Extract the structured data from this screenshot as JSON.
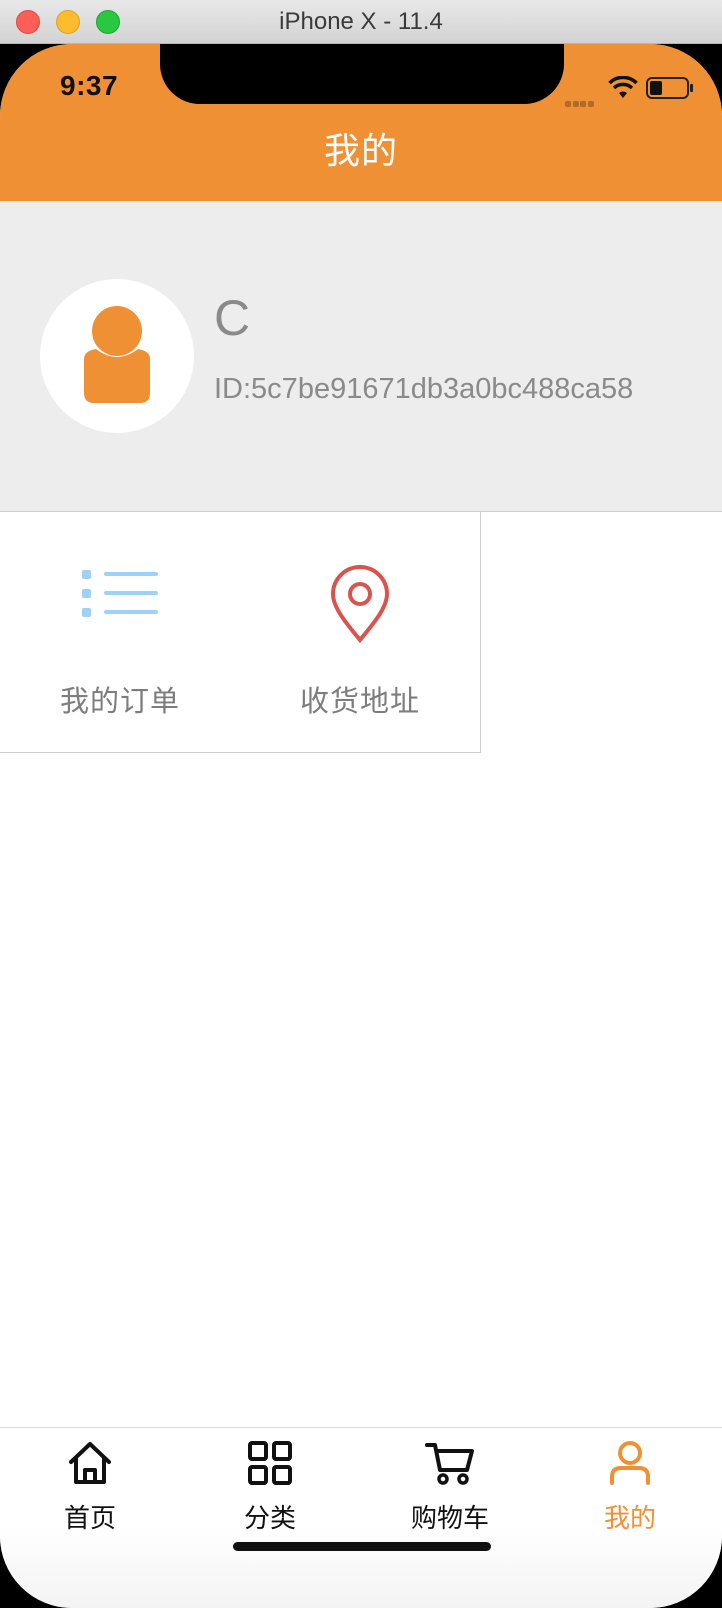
{
  "window": {
    "title": "iPhone X - 11.4"
  },
  "status_bar": {
    "time": "9:37"
  },
  "header": {
    "title": "我的"
  },
  "profile": {
    "name": "C",
    "id_text": "ID:5c7be91671db3a0bc488ca58"
  },
  "menu": [
    {
      "label": "我的订单",
      "icon": "list-icon",
      "color": "#9fd0f5"
    },
    {
      "label": "收货地址",
      "icon": "location-pin-icon",
      "color": "#d9534f"
    }
  ],
  "tabbar": {
    "items": [
      {
        "label": "首页",
        "icon": "home-icon",
        "active": false
      },
      {
        "label": "分类",
        "icon": "grid-icon",
        "active": false
      },
      {
        "label": "购物车",
        "icon": "cart-icon",
        "active": false
      },
      {
        "label": "我的",
        "icon": "user-icon",
        "active": true
      }
    ]
  },
  "colors": {
    "accent": "#f09035",
    "profile_bg": "#ededed",
    "text_muted": "#8a8a8a"
  }
}
